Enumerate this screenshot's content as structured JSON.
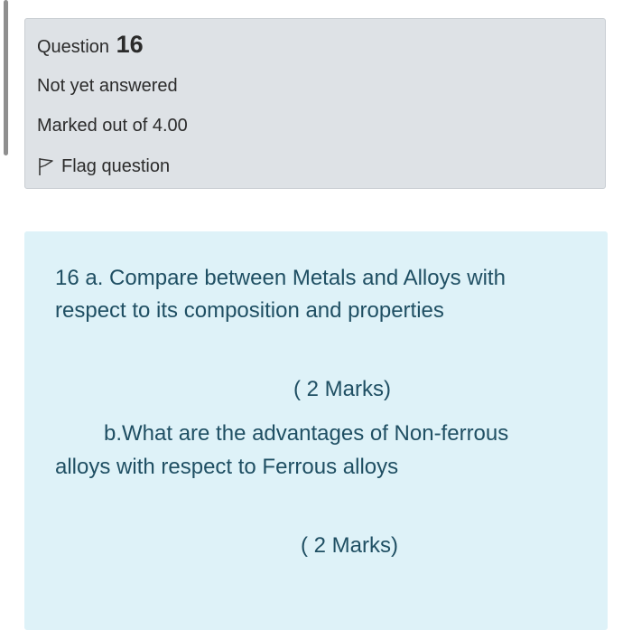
{
  "info": {
    "question_label": "Question",
    "question_number": "16",
    "state": "Not yet answered",
    "grade": "Marked out of 4.00",
    "flag_label": "Flag question"
  },
  "question_text": {
    "line1": "16   a. Compare between Metals and Alloys with",
    "line2": "respect to its composition and properties",
    "marks_a": "( 2 Marks)",
    "line3": "b.What are the advantages of Non-ferrous",
    "line4": "alloys with respect to Ferrous alloys",
    "marks_b": "( 2 Marks)"
  },
  "colors": {
    "info_background": "#dee2e6",
    "content_background": "#def2f8",
    "content_text": "#1f4f63"
  },
  "icons": {
    "flag": "flag-icon"
  }
}
